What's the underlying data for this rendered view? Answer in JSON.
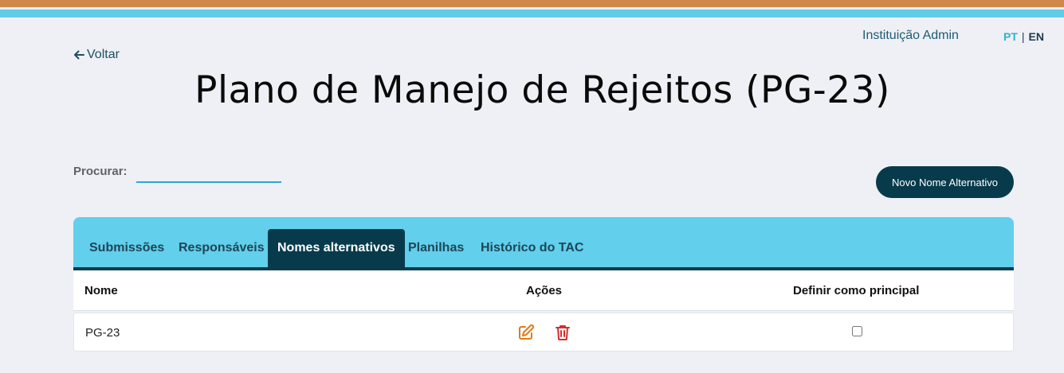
{
  "header": {
    "user_label": "Instituição Admin",
    "languages": {
      "pt": "PT",
      "separator": "|",
      "en": "EN",
      "active": "PT"
    }
  },
  "nav": {
    "back_label": "Voltar"
  },
  "page": {
    "title": "Plano de Manejo de Rejeitos (PG-23)"
  },
  "search": {
    "label": "Procurar:",
    "value": "",
    "placeholder": ""
  },
  "actions": {
    "new_alt_name_label": "Novo Nome Alternativo"
  },
  "tabs": [
    {
      "label": "Submissões",
      "active": false
    },
    {
      "label": "Responsáveis",
      "active": false
    },
    {
      "label": "Nomes alternativos",
      "active": true
    },
    {
      "label": "Planilhas",
      "active": false
    },
    {
      "label": "Histórico do TAC",
      "active": false
    }
  ],
  "table": {
    "columns": [
      "Nome",
      "Ações",
      "Definir como principal"
    ],
    "rows": [
      {
        "name": "PG-23",
        "actions": [
          "pencil-edit-icon",
          "trash-icon"
        ],
        "principal": false
      }
    ]
  },
  "colors": {
    "accent_orange": "#d0874a",
    "accent_blue": "#62cbe8",
    "dark_teal": "#073b4c",
    "edit_icon": "#e07b1a",
    "delete_icon": "#d32f2f"
  }
}
